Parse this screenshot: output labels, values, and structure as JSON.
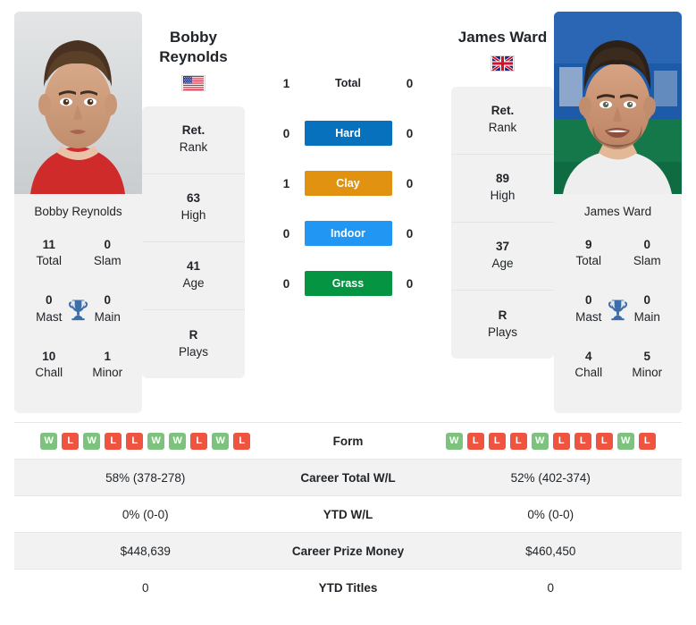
{
  "players": {
    "left": {
      "name": "Bobby Reynolds",
      "display_name_line1": "Bobby",
      "display_name_line2": "Reynolds",
      "flag": "us-flag-icon",
      "card_name": "Bobby Reynolds",
      "titles": [
        {
          "value": "11",
          "label": "Total"
        },
        {
          "value": "0",
          "label": "Slam"
        },
        {
          "value": "0",
          "label": "Mast"
        },
        {
          "value": "0",
          "label": "Main"
        },
        {
          "value": "10",
          "label": "Chall"
        },
        {
          "value": "1",
          "label": "Minor"
        }
      ],
      "info": [
        {
          "value": "Ret.",
          "label": "Rank"
        },
        {
          "value": "63",
          "label": "High"
        },
        {
          "value": "41",
          "label": "Age"
        },
        {
          "value": "R",
          "label": "Plays"
        }
      ],
      "form": [
        "W",
        "L",
        "W",
        "L",
        "L",
        "W",
        "W",
        "L",
        "W",
        "L"
      ],
      "career_total_wl": "58% (378-278)",
      "ytd_wl": "0% (0-0)",
      "career_prize_money": "$448,639",
      "ytd_titles": "0"
    },
    "right": {
      "name": "James Ward",
      "display_name_line1": "James Ward",
      "display_name_line2": "",
      "flag": "gb-flag-icon",
      "card_name": "James Ward",
      "titles": [
        {
          "value": "9",
          "label": "Total"
        },
        {
          "value": "0",
          "label": "Slam"
        },
        {
          "value": "0",
          "label": "Mast"
        },
        {
          "value": "0",
          "label": "Main"
        },
        {
          "value": "4",
          "label": "Chall"
        },
        {
          "value": "5",
          "label": "Minor"
        }
      ],
      "info": [
        {
          "value": "Ret.",
          "label": "Rank"
        },
        {
          "value": "89",
          "label": "High"
        },
        {
          "value": "37",
          "label": "Age"
        },
        {
          "value": "R",
          "label": "Plays"
        }
      ],
      "form": [
        "W",
        "L",
        "L",
        "L",
        "W",
        "L",
        "L",
        "L",
        "W",
        "L"
      ],
      "career_total_wl": "52% (402-374)",
      "ytd_wl": "0% (0-0)",
      "career_prize_money": "$460,450",
      "ytd_titles": "0"
    }
  },
  "h2h": [
    {
      "label": "Total",
      "left": "1",
      "right": "0",
      "type": "plain",
      "color": ""
    },
    {
      "label": "Hard",
      "left": "0",
      "right": "0",
      "type": "badge",
      "color": "#0771bd"
    },
    {
      "label": "Clay",
      "left": "1",
      "right": "0",
      "type": "badge",
      "color": "#e29211"
    },
    {
      "label": "Indoor",
      "left": "0",
      "right": "0",
      "type": "badge",
      "color": "#2196f3"
    },
    {
      "label": "Grass",
      "left": "0",
      "right": "0",
      "type": "badge",
      "color": "#059441"
    }
  ],
  "table_rows": [
    {
      "label": "Form",
      "type": "form"
    },
    {
      "label": "Career Total W/L",
      "type": "text",
      "left": "58% (378-278)",
      "right": "52% (402-374)"
    },
    {
      "label": "YTD W/L",
      "type": "text",
      "left": "0% (0-0)",
      "right": "0% (0-0)"
    },
    {
      "label": "Career Prize Money",
      "type": "text",
      "left": "$448,639",
      "right": "$460,450"
    },
    {
      "label": "YTD Titles",
      "type": "text",
      "left": "0",
      "right": "0"
    }
  ],
  "colors": {
    "win": "#7dc37d",
    "loss": "#ef5441",
    "hard": "#0771bd",
    "clay": "#e29211",
    "indoor": "#2196f3",
    "grass": "#059441",
    "trophy": "#3e6ea8",
    "card_bg": "#f1f1f1",
    "row_alt_bg": "#f2f2f2"
  }
}
